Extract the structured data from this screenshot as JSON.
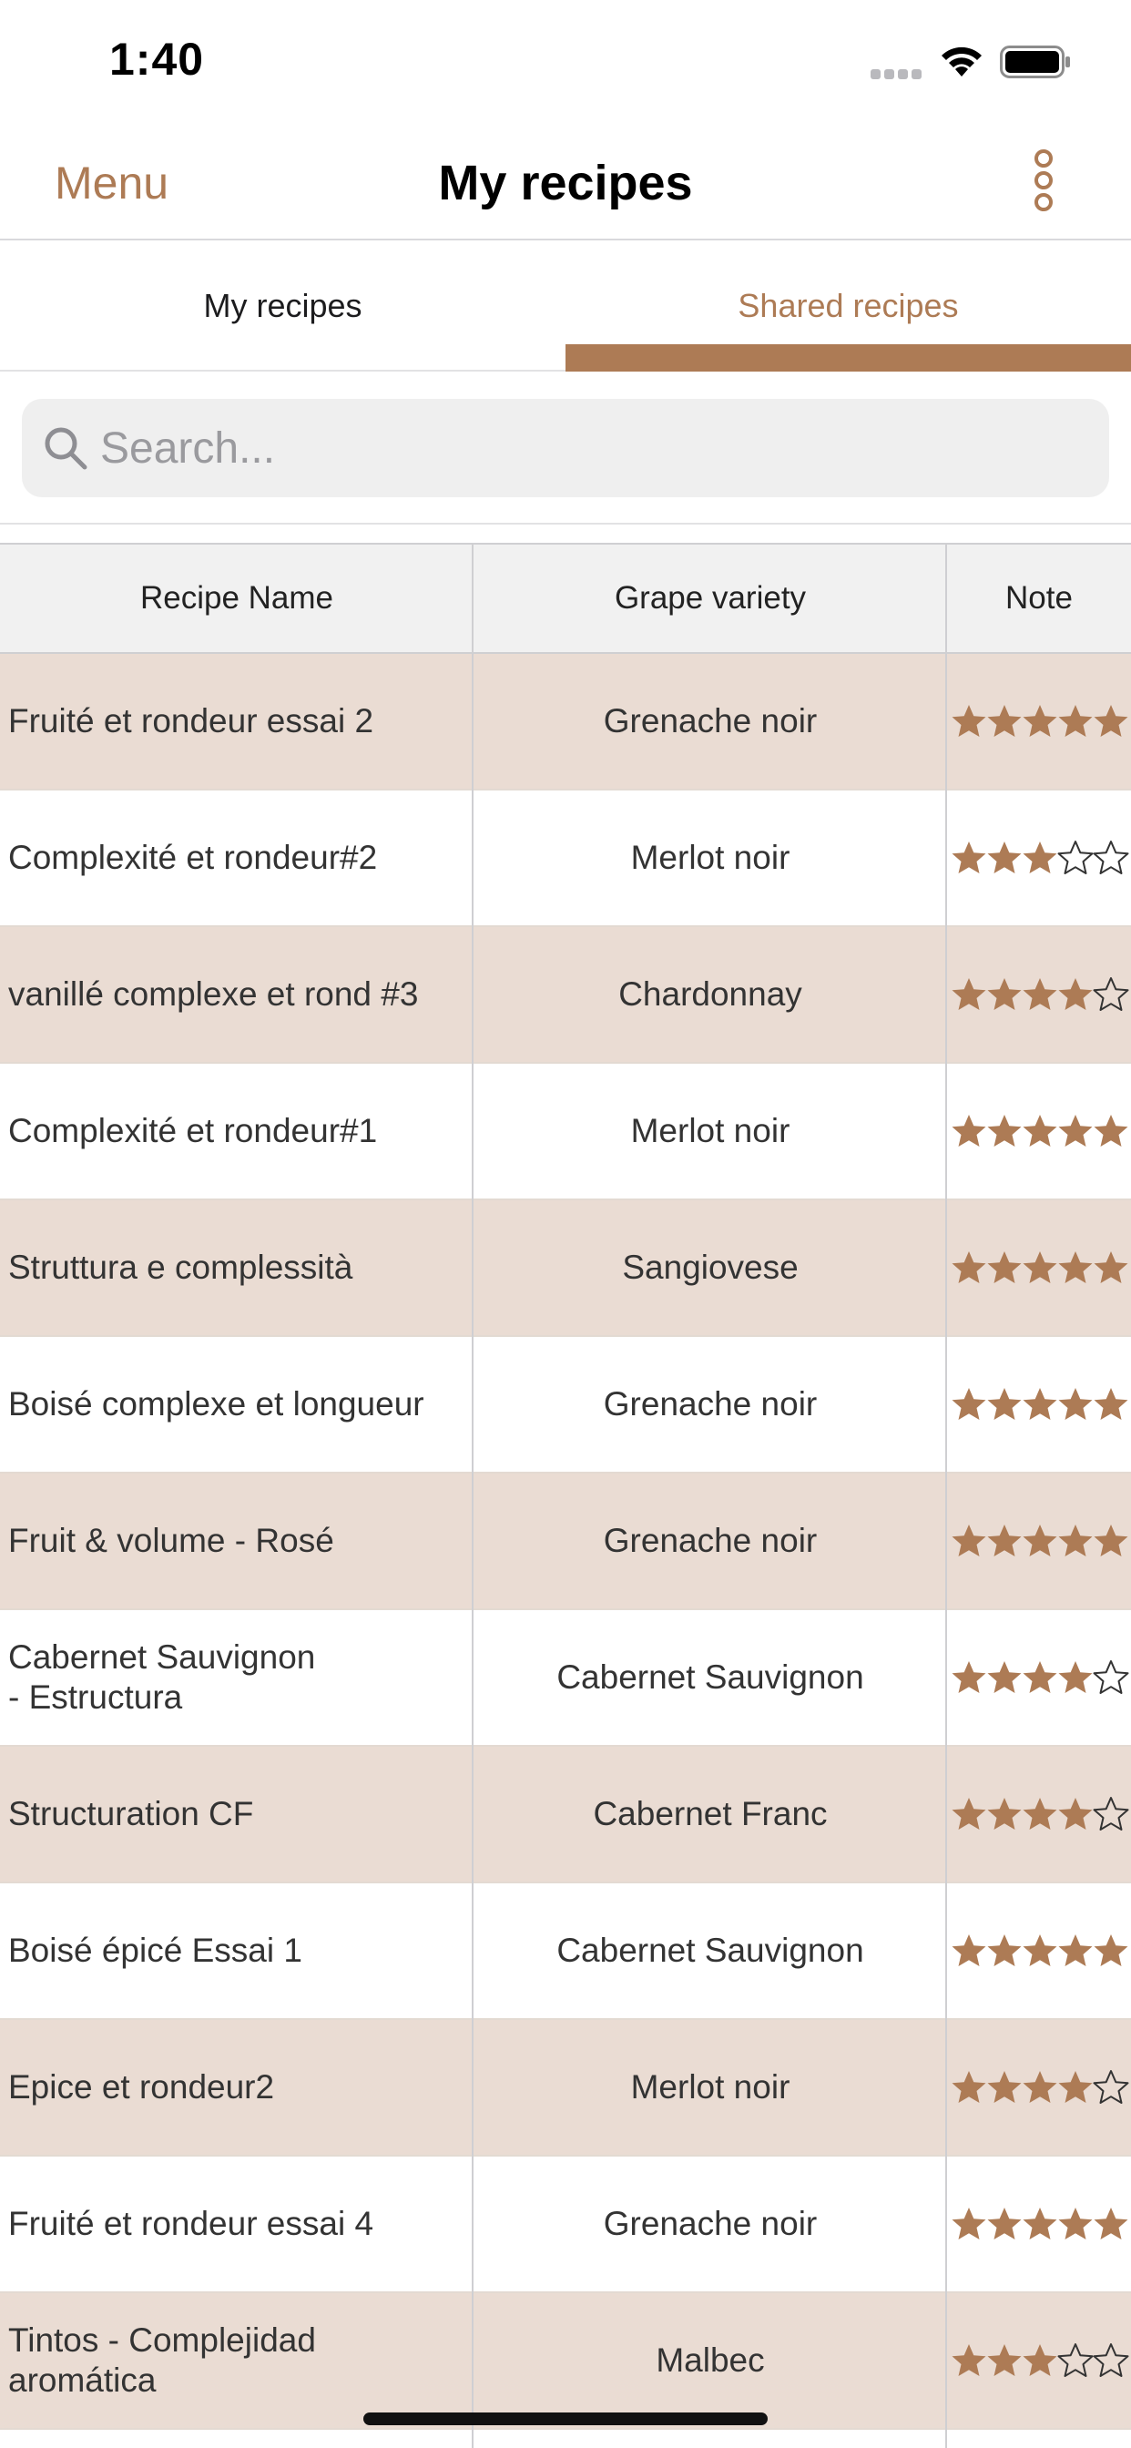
{
  "status_bar": {
    "time": "1:40"
  },
  "nav": {
    "menu_label": "Menu",
    "title": "My recipes",
    "more_icon": "vertical-dots-icon"
  },
  "tabs": [
    {
      "label": "My recipes",
      "active": false
    },
    {
      "label": "Shared recipes",
      "active": true
    }
  ],
  "search": {
    "placeholder": "Search...",
    "value": ""
  },
  "table": {
    "headers": {
      "name": "Recipe Name",
      "grape": "Grape variety",
      "note": "Note"
    },
    "rows": [
      {
        "name": "Fruité et rondeur essai 2",
        "grape": "Grenache noir",
        "rating": 5
      },
      {
        "name": "Complexité et rondeur#2",
        "grape": "Merlot noir",
        "rating": 3
      },
      {
        "name": "vanillé complexe et rond #3",
        "grape": "Chardonnay",
        "rating": 4
      },
      {
        "name": "Complexité et rondeur#1",
        "grape": "Merlot noir",
        "rating": 5
      },
      {
        "name": "Struttura e complessità",
        "grape": "Sangiovese",
        "rating": 5
      },
      {
        "name": "Boisé complexe et longueur",
        "grape": "Grenache noir",
        "rating": 5
      },
      {
        "name": "Fruit & volume - Rosé",
        "grape": "Grenache noir",
        "rating": 5
      },
      {
        "name": "Cabernet Sauvignon\n- Estructura",
        "grape": "Cabernet Sauvignon",
        "rating": 4
      },
      {
        "name": "Structuration CF",
        "grape": "Cabernet Franc",
        "rating": 4
      },
      {
        "name": "Boisé épicé Essai 1",
        "grape": "Cabernet Sauvignon",
        "rating": 5
      },
      {
        "name": "Epice et rondeur2",
        "grape": "Merlot noir",
        "rating": 4
      },
      {
        "name": "Fruité et rondeur essai 4",
        "grape": "Grenache noir",
        "rating": 5
      },
      {
        "name": "Tintos - Complejidad\naromática",
        "grape": "Malbec",
        "rating": 3
      }
    ]
  },
  "colors": {
    "accent": "#ad7b55",
    "row_alt": "#eadcd3",
    "star_empty": "#333333"
  }
}
